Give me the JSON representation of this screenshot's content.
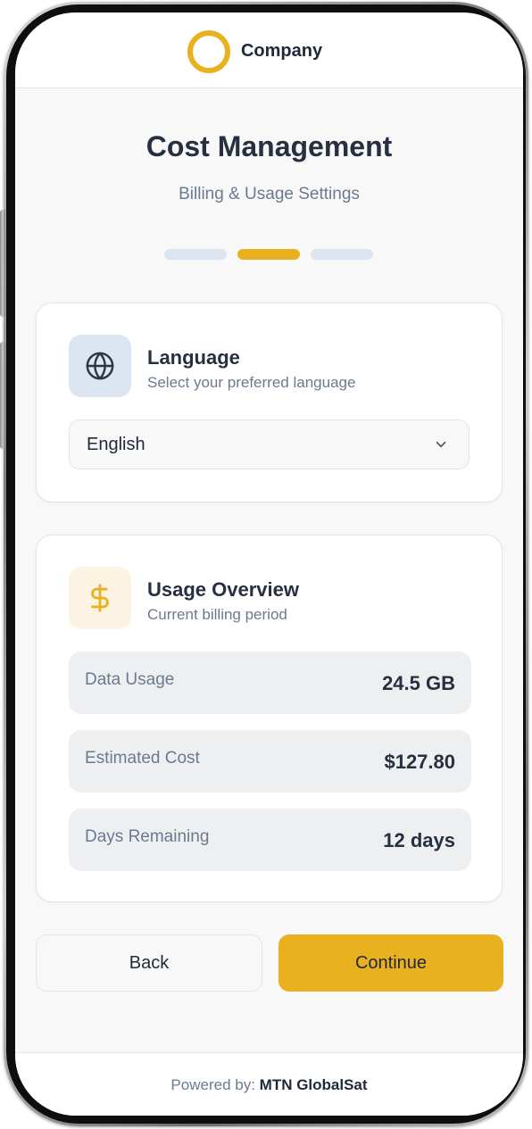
{
  "header": {
    "company_name": "Company",
    "logo_icon": "ring-logo-icon",
    "logo_color": "#e9b020"
  },
  "page": {
    "title": "Cost Management",
    "subtitle": "Billing & Usage Settings"
  },
  "progress": {
    "steps": 3,
    "current_step": 2,
    "accent": "#e9b020"
  },
  "language_card": {
    "title": "Language",
    "subtitle": "Select your preferred language",
    "icon": "globe-icon",
    "selected_language": "English",
    "dropdown_icon": "chevron-down-icon"
  },
  "usage_card": {
    "title": "Usage Overview",
    "subtitle": "Current billing period",
    "icon": "dollar-icon",
    "stats": [
      {
        "label": "Data Usage",
        "value": "24.5 GB"
      },
      {
        "label": "Estimated Cost",
        "value": "$127.80"
      },
      {
        "label": "Days Remaining",
        "value": "12 days"
      }
    ]
  },
  "actions": {
    "back_label": "Back",
    "continue_label": "Continue"
  },
  "footer": {
    "powered_by": "Powered by:",
    "brand": "MTN GlobalSat"
  }
}
